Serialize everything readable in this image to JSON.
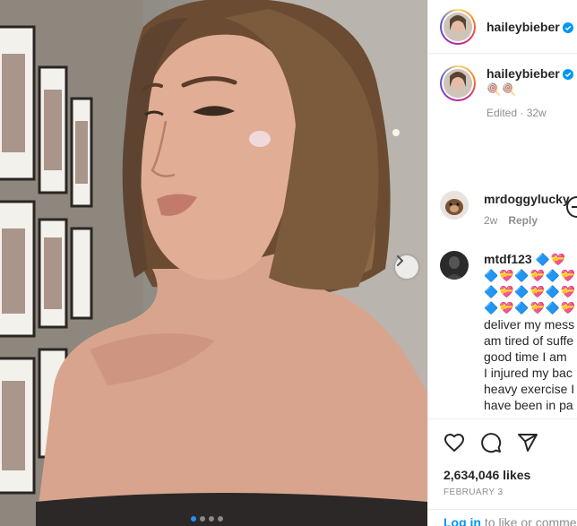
{
  "post": {
    "author": "haileybieber",
    "caption_emoji": "🍭🍭",
    "edited_label": "Edited",
    "age": "32w",
    "likes": "2,634,046 likes",
    "date": "FEBRUARY 3",
    "carousel_total": 4,
    "carousel_active": 1
  },
  "comments": [
    {
      "user": "mrdoggylucky",
      "age": "2w",
      "reply_label": "Reply"
    },
    {
      "user": "mtdf123",
      "emoji_inline": "🔷💝",
      "emoji_lines": [
        "🔷💝🔷💝🔷💝",
        "🔷💝🔷💝🔷💝",
        "🔷💝🔷💝🔷💝"
      ],
      "text_lines": [
        "deliver my mess",
        "am tired of suffe",
        "good time I am",
        "I injured my bac",
        "heavy exercise I",
        "have been in pa"
      ]
    }
  ],
  "footer": {
    "login_link": "Log in",
    "login_rest": " to like or comme"
  },
  "colors": {
    "verified": "#0095f6",
    "link": "#0095f6",
    "dot_active": "#1e90ff"
  },
  "icons": [
    "heart-icon",
    "comment-icon",
    "share-icon",
    "chevron-right-icon",
    "verified-badge-icon",
    "add-circle-icon"
  ]
}
